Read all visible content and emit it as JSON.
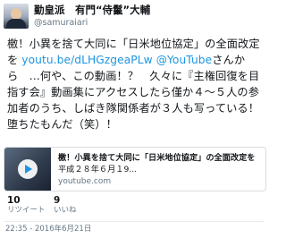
{
  "header": {
    "name": "勤皇派　有門“侍鬣”大輔",
    "handle": "@samuraiari"
  },
  "tweet": {
    "text_part1": "檄！小異を捨て大同に「日米地位協定」の全面改定を ",
    "link1": "youtu.be/dLHGzgeaPLw",
    "text_part2": " ",
    "link2": "@YouTube",
    "text_part3": "さんから　…何や、この動画！？　久々に『主権回復を目指す会』動画集にアクセスしたら僅か４～５人の参加者のうち、しばき隊関係者が３人も写っている！　堕ちたもんだ（笑）！"
  },
  "card": {
    "title": "檄！小異を捨て大同に「日米地位協定」の全面改定を",
    "description": "平成２８年６月１9...",
    "domain": "youtube.com"
  },
  "stats": [
    {
      "count": "10",
      "label": "リツイート"
    },
    {
      "count": "9",
      "label": "いいね"
    }
  ],
  "timestamp": "22:35 - 2016年6月21日",
  "colors": {
    "link": "#1b95e0",
    "secondary_text": "#657786",
    "border": "#d8dde1"
  }
}
